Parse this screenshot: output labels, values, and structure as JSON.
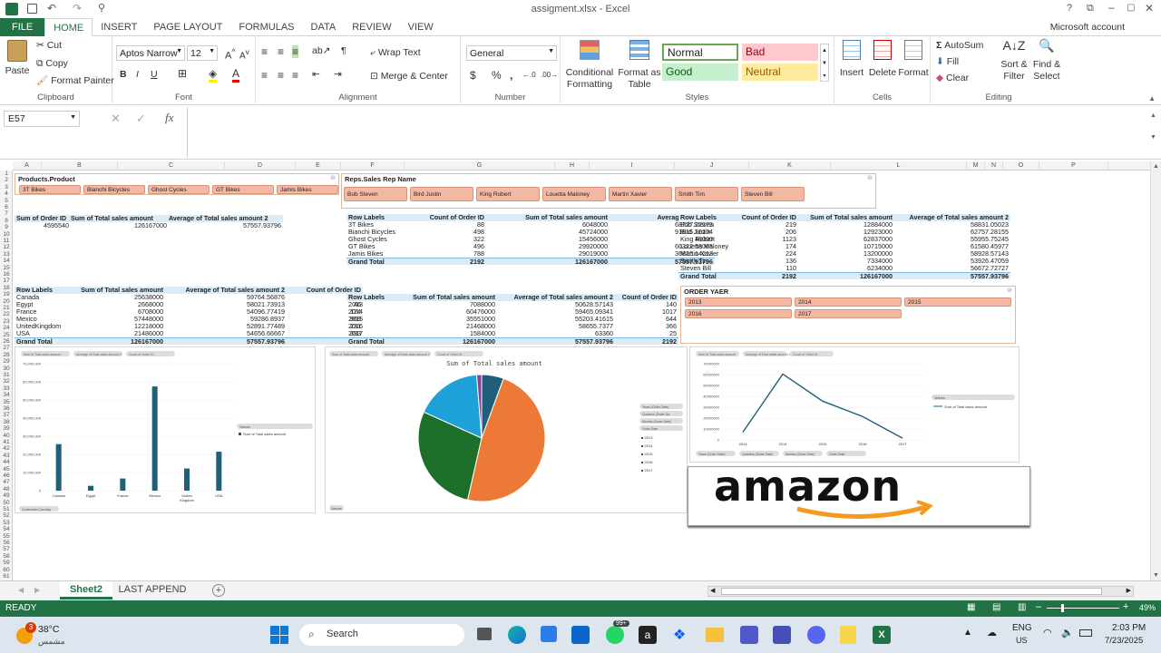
{
  "window": {
    "title": "assigment.xlsx - Excel"
  },
  "ribbon_tabs": [
    "FILE",
    "HOME",
    "INSERT",
    "PAGE LAYOUT",
    "FORMULAS",
    "DATA",
    "REVIEW",
    "VIEW"
  ],
  "account": "Microsoft account",
  "clipboard": {
    "paste": "Paste",
    "cut": "Cut",
    "copy": "Copy",
    "painter": "Format Painter",
    "label": "Clipboard"
  },
  "font": {
    "name": "Aptos Narrow",
    "size": "12",
    "label": "Font",
    "bold": "B",
    "italic": "I",
    "underline": "U"
  },
  "alignment": {
    "wrap": "Wrap Text",
    "merge": "Merge & Center",
    "label": "Alignment"
  },
  "number": {
    "format": "General",
    "label": "Number",
    "currency": "$",
    "percent": "%",
    "comma": ","
  },
  "styles": {
    "cond": "Conditional",
    "cond2": "Formatting",
    "fat": "Format as",
    "fat2": "Table",
    "normal": "Normal",
    "bad": "Bad",
    "good": "Good",
    "neutral": "Neutral",
    "label": "Styles"
  },
  "cells": {
    "insert": "Insert",
    "delete": "Delete",
    "format": "Format",
    "label": "Cells"
  },
  "editing": {
    "autosum": "AutoSum",
    "fill": "Fill",
    "clear": "Clear",
    "sort": "Sort &",
    "sort2": "Filter",
    "find": "Find &",
    "find2": "Select",
    "label": "Editing"
  },
  "formula_bar": {
    "name_box": "E57",
    "fx": "fx",
    "value": ""
  },
  "columns": [
    "A",
    "B",
    "C",
    "D",
    "E",
    "F",
    "G",
    "H",
    "I",
    "J",
    "K",
    "L",
    "M",
    "N",
    "O",
    "P"
  ],
  "rows": [
    "1",
    "2",
    "3",
    "4",
    "5",
    "6",
    "7",
    "8",
    "9",
    "10",
    "11",
    "12",
    "13",
    "14",
    "15",
    "16",
    "17",
    "18",
    "19",
    "20",
    "21",
    "22",
    "23",
    "24",
    "25",
    "26",
    "27",
    "28",
    "29",
    "30",
    "31",
    "32",
    "33",
    "34",
    "35",
    "36",
    "37",
    "38",
    "39",
    "40",
    "41",
    "42",
    "43",
    "44",
    "45",
    "46",
    "47",
    "48",
    "49",
    "50",
    "51",
    "52",
    "53",
    "54",
    "55",
    "56",
    "57",
    "58",
    "59",
    "60",
    "61"
  ],
  "slicer_product": {
    "title": "Products.Product",
    "items": [
      "3T Bikes",
      "Bianchi Bicycles",
      "Ghost Cycles",
      "GT Bikes",
      "Jamis Bikes"
    ]
  },
  "slicer_rep": {
    "title": "Reps.Sales Rep Name",
    "items": [
      "Bob Steven",
      "Bird Justin",
      "King Robert",
      "Louetta Maloney",
      "Martin Xavier",
      "Smith Tim",
      "Steven Bill"
    ]
  },
  "slicer_year": {
    "title": "ORDER YAER",
    "items": [
      "2013",
      "2014",
      "2015",
      "2016",
      "2017"
    ]
  },
  "pivot_summary": {
    "headers": [
      "Sum of Order ID",
      "Sum of Total sales amount",
      "Average of Total sales amount 2"
    ],
    "values": [
      "4595540",
      "126167000",
      "57557.93796"
    ]
  },
  "pivot_product": {
    "headers": [
      "Row Labels",
      "Count of Order ID",
      "Sum of Total sales amount",
      "Average of Total s"
    ],
    "rows": [
      [
        "3T Bikes",
        "88",
        "6048000",
        "68727.27273"
      ],
      [
        "Bianchi Bicycles",
        "498",
        "45724000",
        "91815.26104"
      ],
      [
        "Ghost Cycles",
        "322",
        "15456000",
        "48000"
      ],
      [
        "GT Bikes",
        "496",
        "29920000",
        "60322.58065"
      ],
      [
        "Jamis Bikes",
        "788",
        "29019000",
        "36826.14213"
      ]
    ],
    "total": [
      "Grand Total",
      "2192",
      "126167000",
      "57557.93796"
    ]
  },
  "pivot_rep": {
    "headers": [
      "Row Labels",
      "Count of Order ID",
      "Sum of Total sales amount",
      "Average of Total sales amount 2"
    ],
    "rows": [
      [
        "Bob Steven",
        "219",
        "12884000",
        "58831.05023"
      ],
      [
        "Bird Justin",
        "206",
        "12923000",
        "62757.28155"
      ],
      [
        "King Robert",
        "1123",
        "62837000",
        "55955.75245"
      ],
      [
        "Louetta Maloney",
        "174",
        "10715000",
        "61580.45977"
      ],
      [
        "Martin Xavier",
        "224",
        "13200000",
        "58928.57143"
      ],
      [
        "Smith Tim",
        "136",
        "7334000",
        "53926.47059"
      ],
      [
        "Steven Bill",
        "110",
        "6234000",
        "56672.72727"
      ]
    ],
    "total": [
      "Grand Total",
      "2192",
      "126167000",
      "57557.93796"
    ]
  },
  "pivot_country": {
    "headers": [
      "Row Labels",
      "Sum of Total sales amount",
      "Average of Total sales amount 2",
      "Count of Order ID"
    ],
    "rows": [
      [
        "Canada",
        "25638000",
        "59764.56876",
        "429"
      ],
      [
        "Egypt",
        "2668000",
        "58021.73913",
        "46"
      ],
      [
        "France",
        "6708000",
        "54096.77419",
        "124"
      ],
      [
        "Mexico",
        "57448000",
        "59286.8937",
        "969"
      ],
      [
        "UnitedKingdom",
        "12218000",
        "52891.77489",
        "231"
      ],
      [
        "USA",
        "21486000",
        "54656.66667",
        "393"
      ]
    ],
    "total": [
      "Grand Total",
      "126167000",
      "57557.93796",
      "2192"
    ]
  },
  "pivot_year": {
    "headers": [
      "Row Labels",
      "Sum of Total sales amount",
      "Average of Total sales amount 2",
      "Count of Order ID"
    ],
    "rows": [
      [
        "2013",
        "7088000",
        "50628.57143",
        "140"
      ],
      [
        "2014",
        "60476000",
        "59465.09341",
        "1017"
      ],
      [
        "2015",
        "35551000",
        "55203.41615",
        "644"
      ],
      [
        "2016",
        "21468000",
        "58655.7377",
        "366"
      ],
      [
        "2017",
        "1584000",
        "63360",
        "25"
      ]
    ],
    "total": [
      "Grand Total",
      "126167000",
      "57557.93796",
      "2192"
    ]
  },
  "chart_data": [
    {
      "type": "bar",
      "categories": [
        "Canada",
        "Egypt",
        "France",
        "Mexico",
        "United Kingdom",
        "USA"
      ],
      "series": [
        {
          "name": "Sum of Total sales amount",
          "values": [
            25638000,
            2668000,
            6708000,
            57448000,
            12218000,
            21486000
          ]
        }
      ],
      "y_ticks": [
        "70,000,000",
        "60,000,000",
        "50,000,000",
        "40,000,000",
        "30,000,000",
        "20,000,000",
        "10,000,000",
        "0"
      ],
      "ylim": [
        0,
        70000000
      ],
      "legend": "right",
      "legend_title": "Values",
      "color": "#1f5f7a",
      "field_buttons": [
        "Sum of Total sales amount",
        "Average of Total sales amount 2",
        "Count of Order ID"
      ],
      "axis_button": "Customer.Country"
    },
    {
      "type": "pie",
      "title": "Sum of Total sales amount",
      "categories": [
        "2013",
        "2014",
        "2015",
        "2016",
        "2017"
      ],
      "values": [
        7088000,
        60476000,
        35551000,
        21468000,
        1584000
      ],
      "colors": [
        "#1f5f7a",
        "#ec7a36",
        "#1e6f2a",
        "#1ea0d8",
        "#8b3e9c"
      ],
      "legend": "right",
      "legend_title": "Orders.Order Date (Year)",
      "field_buttons": [
        "Sum of Total sales amount",
        "Average of Total sales amount 2",
        "Count of Order ID"
      ],
      "axis_button": "Values",
      "right_buttons": [
        "Years (Order Date)",
        "Quarters (Order Da",
        "Months (Order Date)",
        "Order Date"
      ]
    },
    {
      "type": "line",
      "categories": [
        "2013",
        "2014",
        "2015",
        "2016",
        "2017"
      ],
      "series": [
        {
          "name": "Sum of Total sales amount",
          "values": [
            7088000,
            60476000,
            35551000,
            21468000,
            1584000
          ]
        }
      ],
      "y_ticks": [
        "70000000",
        "60000000",
        "50000000",
        "40000000",
        "30000000",
        "20000000",
        "10000000",
        "0"
      ],
      "ylim": [
        0,
        70000000
      ],
      "legend": "right",
      "legend_title": "Values",
      "color": "#1f5f7a",
      "field_buttons": [
        "Sum of Total sales amount",
        "Average of Total sales amount 2",
        "Count of Order ID"
      ],
      "axis_buttons": [
        "Years (Order Date)",
        "Quarters (Order Date)",
        "Months (Order Date)",
        "Order Date"
      ]
    }
  ],
  "logo": {
    "text": "amazon"
  },
  "sheets": {
    "active": "Sheet2",
    "other": "LAST APPEND",
    "add": "+"
  },
  "status": {
    "ready": "READY",
    "zoom": "49%"
  },
  "taskbar": {
    "temp": "38°C",
    "weather": "مشمس",
    "badge": "3",
    "search": "Search",
    "lang": "ENG",
    "region": "US",
    "time": "2:03 PM",
    "date": "7/23/2025",
    "badge2": "99+"
  }
}
